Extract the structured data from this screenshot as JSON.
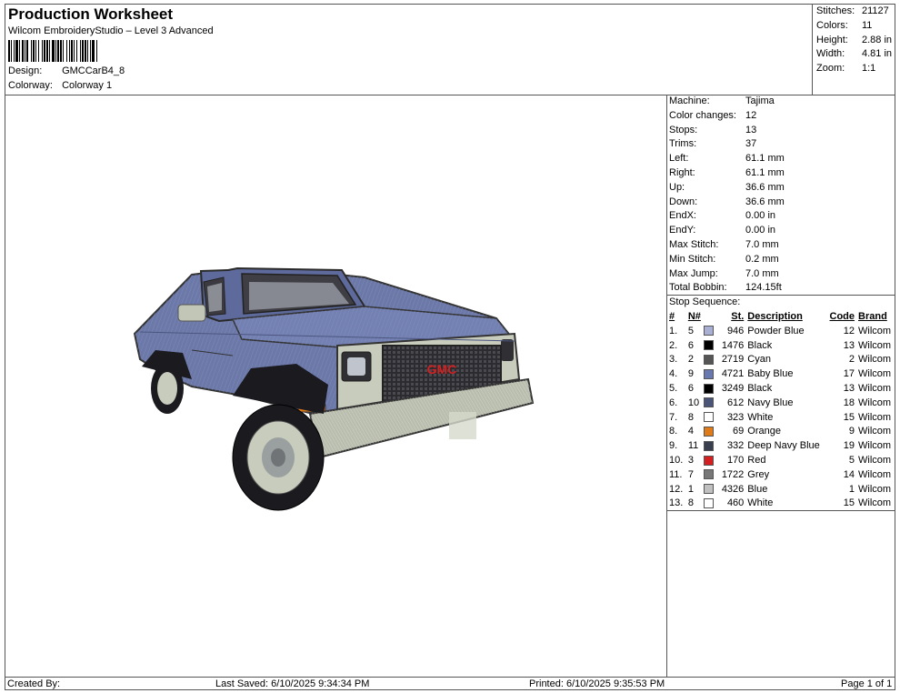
{
  "header": {
    "title": "Production Worksheet",
    "subtitle": "Wilcom EmbroideryStudio – Level 3 Advanced",
    "design_label": "Design:",
    "design_value": "GMCCarB4_8",
    "colorway_label": "Colorway:",
    "colorway_value": "Colorway 1"
  },
  "summary": [
    {
      "label": "Stitches:",
      "value": "21127"
    },
    {
      "label": "Colors:",
      "value": "11"
    },
    {
      "label": "Height:",
      "value": "2.88 in"
    },
    {
      "label": "Width:",
      "value": "4.81 in"
    },
    {
      "label": "Zoom:",
      "value": "1:1"
    }
  ],
  "stats": [
    {
      "label": "Machine:",
      "value": "Tajima"
    },
    {
      "label": "Color changes:",
      "value": "12"
    },
    {
      "label": "Stops:",
      "value": "13"
    },
    {
      "label": "Trims:",
      "value": "37"
    },
    {
      "label": "Left:",
      "value": "61.1 mm"
    },
    {
      "label": "Right:",
      "value": "61.1 mm"
    },
    {
      "label": "Up:",
      "value": "36.6 mm"
    },
    {
      "label": "Down:",
      "value": "36.6 mm"
    },
    {
      "label": "EndX:",
      "value": "0.00 in"
    },
    {
      "label": "EndY:",
      "value": "0.00 in"
    },
    {
      "label": "Max Stitch:",
      "value": "7.0 mm"
    },
    {
      "label": "Min Stitch:",
      "value": "0.2 mm"
    },
    {
      "label": "Max Jump:",
      "value": "7.0 mm"
    },
    {
      "label": "Total Bobbin:",
      "value": "124.15ft"
    }
  ],
  "stop_sequence": {
    "label": "Stop Sequence:",
    "columns": [
      "#",
      "N#",
      "St.",
      "Description",
      "Code",
      "Brand"
    ],
    "rows": [
      {
        "num": "1.",
        "n": "5",
        "color": "#a9b0d4",
        "st": "946",
        "desc": "Powder Blue",
        "code": "12",
        "brand": "Wilcom"
      },
      {
        "num": "2.",
        "n": "6",
        "color": "#000000",
        "st": "1476",
        "desc": "Black",
        "code": "13",
        "brand": "Wilcom"
      },
      {
        "num": "3.",
        "n": "2",
        "color": "#555555",
        "st": "2719",
        "desc": "Cyan",
        "code": "2",
        "brand": "Wilcom"
      },
      {
        "num": "4.",
        "n": "9",
        "color": "#6a78b0",
        "st": "4721",
        "desc": "Baby Blue",
        "code": "17",
        "brand": "Wilcom"
      },
      {
        "num": "5.",
        "n": "6",
        "color": "#000000",
        "st": "3249",
        "desc": "Black",
        "code": "13",
        "brand": "Wilcom"
      },
      {
        "num": "6.",
        "n": "10",
        "color": "#4a5578",
        "st": "612",
        "desc": "Navy Blue",
        "code": "18",
        "brand": "Wilcom"
      },
      {
        "num": "7.",
        "n": "8",
        "color": "#ffffff",
        "st": "323",
        "desc": "White",
        "code": "15",
        "brand": "Wilcom"
      },
      {
        "num": "8.",
        "n": "4",
        "color": "#e07b1a",
        "st": "69",
        "desc": "Orange",
        "code": "9",
        "brand": "Wilcom"
      },
      {
        "num": "9.",
        "n": "11",
        "color": "#3a3f4f",
        "st": "332",
        "desc": "Deep Navy Blue",
        "code": "19",
        "brand": "Wilcom"
      },
      {
        "num": "10.",
        "n": "3",
        "color": "#d42020",
        "st": "170",
        "desc": "Red",
        "code": "5",
        "brand": "Wilcom"
      },
      {
        "num": "11.",
        "n": "7",
        "color": "#777777",
        "st": "1722",
        "desc": "Grey",
        "code": "14",
        "brand": "Wilcom"
      },
      {
        "num": "12.",
        "n": "1",
        "color": "#c0c0c0",
        "st": "4326",
        "desc": "Blue",
        "code": "1",
        "brand": "Wilcom"
      },
      {
        "num": "13.",
        "n": "8",
        "color": "#ffffff",
        "st": "460",
        "desc": "White",
        "code": "15",
        "brand": "Wilcom"
      }
    ]
  },
  "footer": {
    "created_by": "Created By:",
    "last_saved": "Last Saved: 6/10/2025 9:34:34 PM",
    "printed": "Printed: 6/10/2025 9:35:53 PM",
    "page": "Page 1 of 1"
  },
  "colors": {
    "truck_body": "#6b78a8",
    "truck_dark": "#4c5680",
    "bumper": "#b9bdae",
    "grille": "#2c2c30",
    "logo": "#d42020"
  }
}
